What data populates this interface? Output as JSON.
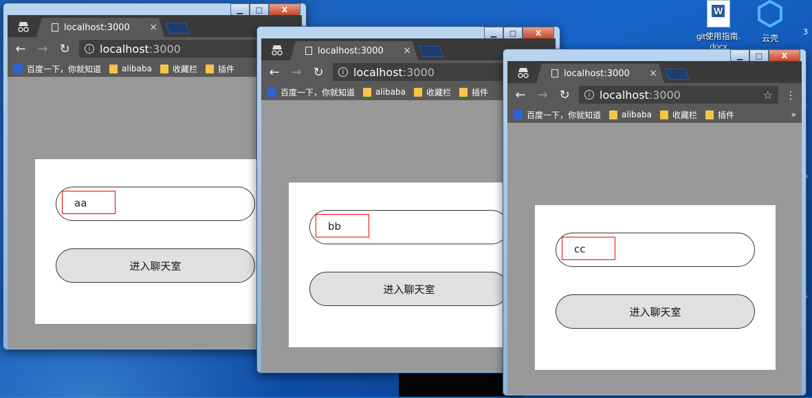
{
  "desktop": {
    "icons": [
      {
        "label_line1": "git使用指南.",
        "label_line2": "docx"
      },
      {
        "label_line1": "云壳",
        "label_line2": ""
      }
    ],
    "edge_text": [
      "3",
      "1",
      "b",
      "5"
    ]
  },
  "windows": [
    {
      "tab_title": "localhost:3000",
      "tab_close": "×",
      "url_host": "localhost",
      "url_port": ":3000",
      "bookmarks": [
        "百度一下，你就知道",
        "alibaba",
        "收藏栏",
        "插件"
      ],
      "username_value": "aa",
      "enter_label": "进入聊天室",
      "caption": {
        "min": "▁",
        "max": "□",
        "close": "X"
      }
    },
    {
      "tab_title": "localhost:3000",
      "tab_close": "×",
      "url_host": "localhost",
      "url_port": ":3000",
      "bookmarks": [
        "百度一下，你就知道",
        "alibaba",
        "收藏栏",
        "插件"
      ],
      "username_value": "bb",
      "enter_label": "进入聊天室",
      "caption": {
        "min": "▁",
        "max": "□",
        "close": "X"
      }
    },
    {
      "tab_title": "localhost:3000",
      "tab_close": "×",
      "url_host": "localhost",
      "url_port": ":3000",
      "bookmarks": [
        "百度一下，你就知道",
        "alibaba",
        "收藏栏",
        "插件"
      ],
      "bookmarks_more": "»",
      "username_value": "cc",
      "enter_label": "进入聊天室",
      "caption": {
        "min": "▁",
        "max": "□",
        "close": "X"
      }
    }
  ],
  "icons": {
    "back": "←",
    "forward": "→",
    "reload": "↻",
    "info": "i",
    "star": "☆",
    "menu": "⋮"
  },
  "colors": {
    "viewport_bg": "#999999",
    "input_highlight": "#e00000",
    "button_bg": "#e0e0e0"
  }
}
